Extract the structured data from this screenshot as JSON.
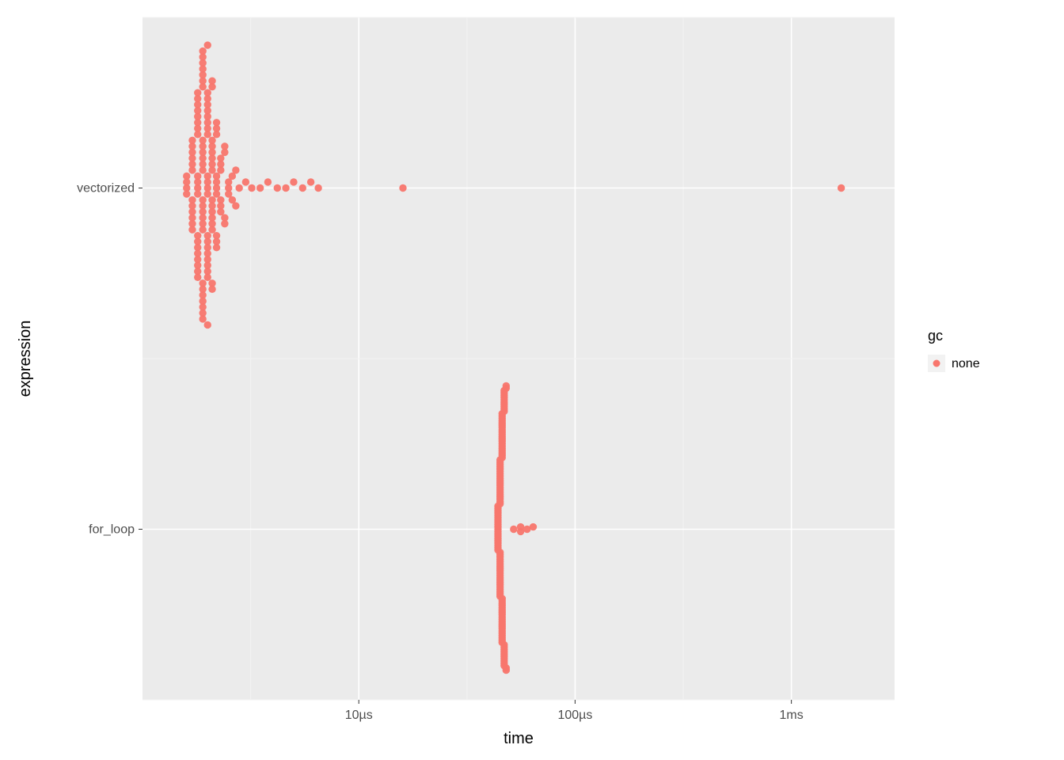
{
  "chart_data": {
    "type": "scatter",
    "title": "",
    "xlabel": "time",
    "ylabel": "expression",
    "x_scale": "log10",
    "x_ticks": [
      {
        "value_sec": 1e-05,
        "label": "10µs"
      },
      {
        "value_sec": 0.0001,
        "label": "100µs"
      },
      {
        "value_sec": 0.001,
        "label": "1ms"
      }
    ],
    "x_range_sec": [
      1e-06,
      0.003
    ],
    "y_categories": [
      "for_loop",
      "vectorized"
    ],
    "legend": {
      "title": "gc",
      "items": [
        {
          "label": "none",
          "color": "#F8766D"
        }
      ]
    },
    "point_color": "#F8766D",
    "series": [
      {
        "name": "vectorized",
        "gc": "none",
        "x_approx_us": [
          1.6,
          1.6,
          1.6,
          1.6,
          1.7,
          1.7,
          1.7,
          1.7,
          1.7,
          1.7,
          1.7,
          1.7,
          1.7,
          1.7,
          1.7,
          1.7,
          1.8,
          1.8,
          1.8,
          1.8,
          1.8,
          1.8,
          1.8,
          1.8,
          1.8,
          1.8,
          1.8,
          1.8,
          1.8,
          1.8,
          1.8,
          1.8,
          1.8,
          1.8,
          1.8,
          1.8,
          1.9,
          1.9,
          1.9,
          1.9,
          1.9,
          1.9,
          1.9,
          1.9,
          1.9,
          1.9,
          1.9,
          1.9,
          1.9,
          1.9,
          1.9,
          1.9,
          1.9,
          1.9,
          1.9,
          1.9,
          1.9,
          1.9,
          1.9,
          1.9,
          1.9,
          1.9,
          2.0,
          2.0,
          2.0,
          2.0,
          2.0,
          2.0,
          2.0,
          2.0,
          2.0,
          2.0,
          2.0,
          2.0,
          2.0,
          2.0,
          2.0,
          2.0,
          2.0,
          2.0,
          2.0,
          2.0,
          2.0,
          2.0,
          2.1,
          2.1,
          2.1,
          2.1,
          2.1,
          2.1,
          2.1,
          2.1,
          2.1,
          2.1,
          2.1,
          2.1,
          2.1,
          2.1,
          2.1,
          2.1,
          2.2,
          2.2,
          2.2,
          2.2,
          2.2,
          2.2,
          2.2,
          2.2,
          2.2,
          2.2,
          2.3,
          2.3,
          2.3,
          2.3,
          2.3,
          2.3,
          2.4,
          2.4,
          2.4,
          2.4,
          2.5,
          2.5,
          2.5,
          2.6,
          2.6,
          2.7,
          2.7,
          2.8,
          3.0,
          3.2,
          3.5,
          3.8,
          4.2,
          4.6,
          5.0,
          5.5,
          6.0,
          6.5,
          16.0,
          1700.0
        ]
      },
      {
        "name": "for_loop",
        "gc": "none",
        "x_approx_us": [
          44,
          44,
          44,
          44,
          44,
          44,
          44,
          44,
          44,
          44,
          44,
          44,
          44,
          44,
          44,
          44,
          44,
          44,
          44,
          44,
          45,
          45,
          45,
          45,
          45,
          45,
          45,
          45,
          45,
          45,
          45,
          45,
          45,
          45,
          45,
          45,
          45,
          45,
          45,
          45,
          45,
          45,
          45,
          45,
          45,
          45,
          45,
          45,
          45,
          45,
          45,
          45,
          45,
          45,
          45,
          45,
          45,
          45,
          45,
          45,
          46,
          46,
          46,
          46,
          46,
          46,
          46,
          46,
          46,
          46,
          46,
          46,
          46,
          46,
          46,
          46,
          46,
          46,
          46,
          46,
          46,
          46,
          46,
          46,
          46,
          46,
          46,
          46,
          46,
          46,
          46,
          46,
          46,
          46,
          46,
          46,
          46,
          46,
          46,
          46,
          47,
          47,
          47,
          47,
          47,
          47,
          47,
          47,
          47,
          47,
          47,
          47,
          47,
          47,
          47,
          47,
          47,
          47,
          47,
          47,
          48,
          48,
          48,
          48,
          52,
          56,
          56,
          60,
          64
        ]
      }
    ]
  }
}
